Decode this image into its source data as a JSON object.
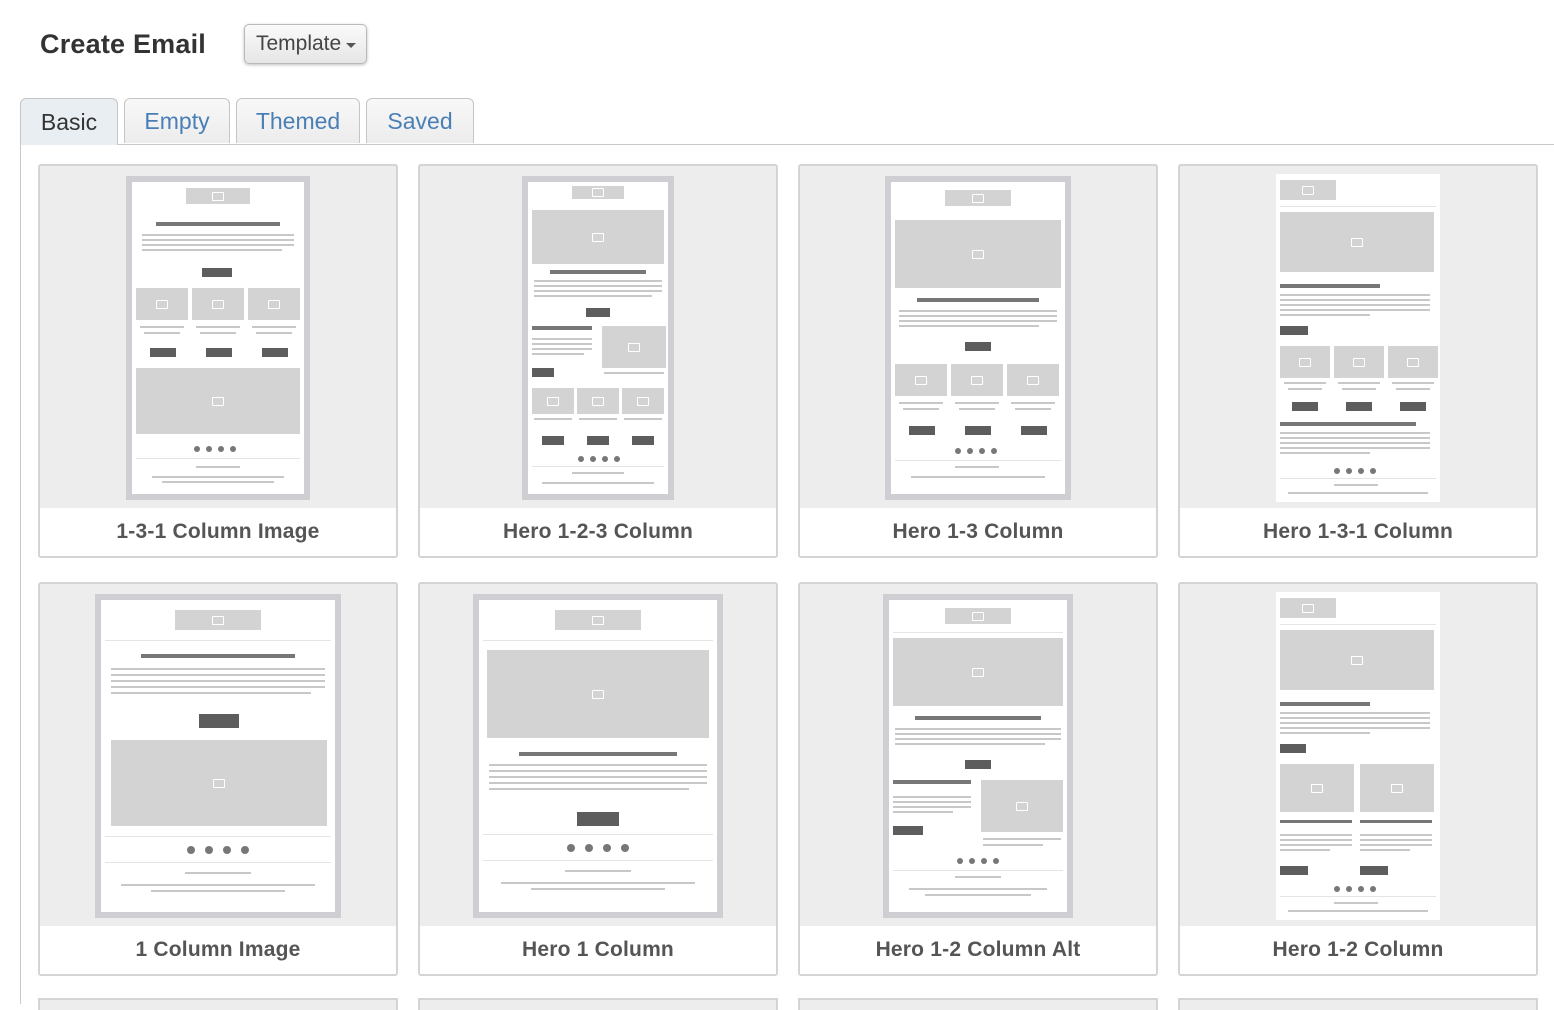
{
  "header": {
    "title": "Create Email",
    "template_dropdown": "Template"
  },
  "tabs": [
    {
      "label": "Basic",
      "active": true
    },
    {
      "label": "Empty",
      "active": false
    },
    {
      "label": "Themed",
      "active": false
    },
    {
      "label": "Saved",
      "active": false
    }
  ],
  "templates": [
    {
      "name": "1-3-1 Column Image"
    },
    {
      "name": "Hero 1-2-3 Column"
    },
    {
      "name": "Hero 1-3 Column"
    },
    {
      "name": "Hero 1-3-1 Column"
    },
    {
      "name": "1 Column Image"
    },
    {
      "name": "Hero 1 Column"
    },
    {
      "name": "Hero 1-2 Column Alt"
    },
    {
      "name": "Hero 1-2 Column"
    }
  ],
  "colors": {
    "accent_tab_text": "#4a7fb5",
    "card_bg": "#ededed",
    "placeholder": "#d3d3d3"
  }
}
